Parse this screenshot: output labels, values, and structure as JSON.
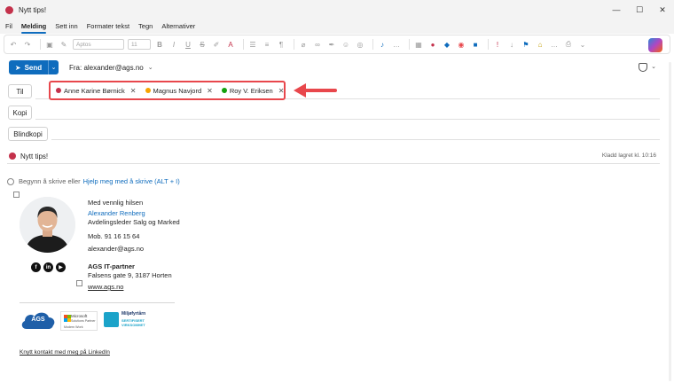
{
  "window": {
    "title": "Nytt tips!",
    "controls": {
      "minimize": "—",
      "maximize": "☐",
      "close": "✕"
    }
  },
  "menu": {
    "items": [
      "Fil",
      "Melding",
      "Sett inn",
      "Formater tekst",
      "Tegn",
      "Alternativer"
    ],
    "active": "Melding"
  },
  "ribbon": {
    "font_name": "Aptos",
    "font_size": "11"
  },
  "compose": {
    "send_label": "Send",
    "from_label": "Fra: alexander@ags.no",
    "to_label": "Til",
    "cc_label": "Kopi",
    "bcc_label": "Blindkopi",
    "recipients": [
      {
        "name": "Anne Karine Børnick",
        "status_color": "#c4314b"
      },
      {
        "name": "Magnus Navjord",
        "status_color": "#f7a400"
      },
      {
        "name": "Roy V. Eriksen",
        "status_color": "#13a10e"
      }
    ],
    "subject": "Nytt tips!",
    "saved_status": "Kladd lagret kl. 10:16"
  },
  "body": {
    "hint_prefix": "Begynn å skrive eller",
    "hint_link": "Hjelp meg med å skrive (ALT + I)"
  },
  "signature": {
    "greeting": "Med vennlig hilsen",
    "name": "Alexander Renberg",
    "title": "Avdelingsleder Salg og Marked",
    "mobile": "Mob.  91 16 15 64",
    "email": "alexander@ags.no",
    "company": "AGS IT-partner",
    "address": "Falsens gate 9, 3187 Horten",
    "website": "www.ags.no",
    "social": [
      "f",
      "in",
      "▶"
    ],
    "logo_ags": "AGS",
    "logo_ms_line1": "Microsoft",
    "logo_ms_line2": "Solutions Partner",
    "logo_ms_line3": "Modern Work",
    "logo_env_line1": "Miljøfyrtårn",
    "logo_env_line2": "SERTIFISERT",
    "logo_env_line3": "VIRKSOMHET",
    "linkedin": "Knytt kontakt med meg på LinkedIn"
  },
  "colors": {
    "accent": "#0f6cbd",
    "highlight_box": "#e8474c"
  }
}
